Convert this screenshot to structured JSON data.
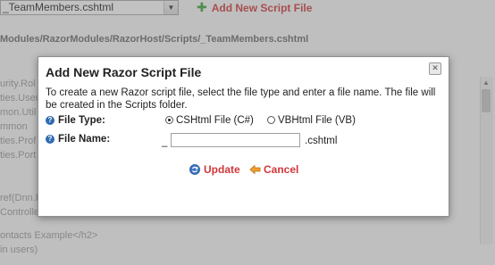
{
  "background": {
    "file_select_value": "_TeamMembers.cshtml",
    "add_script_label": "Add New Script File",
    "path": "Modules/RazorModules/RazorHost/Scripts/_TeamMembers.cshtml",
    "code_lines": [
      "urity.Rol",
      "ties.User",
      "mon.Util",
      "mmon",
      "ties.Prof",
      "ties.Port",
      "",
      "",
      "ref(Dnn.F",
      "Controller"
    ],
    "bottom_lines": [
      "ontacts Example</h2>",
      "in users)"
    ]
  },
  "dialog": {
    "title": "Add New Razor Script File",
    "description": "To create a new Razor script file, select the file type and enter a file name. The file will be created in the Scripts folder.",
    "file_type_label": "File Type:",
    "option_cshtml": "CSHtml File (C#)",
    "option_vbhtml": "VBHtml File (VB)",
    "file_name_label": "File Name:",
    "file_name_prefix": "_",
    "file_name_value": "",
    "file_name_suffix": ".cshtml",
    "update_label": "Update",
    "cancel_label": "Cancel",
    "selected_option": "cshtml"
  },
  "colors": {
    "accent": "#d0373a",
    "help": "#2f6bb0"
  }
}
